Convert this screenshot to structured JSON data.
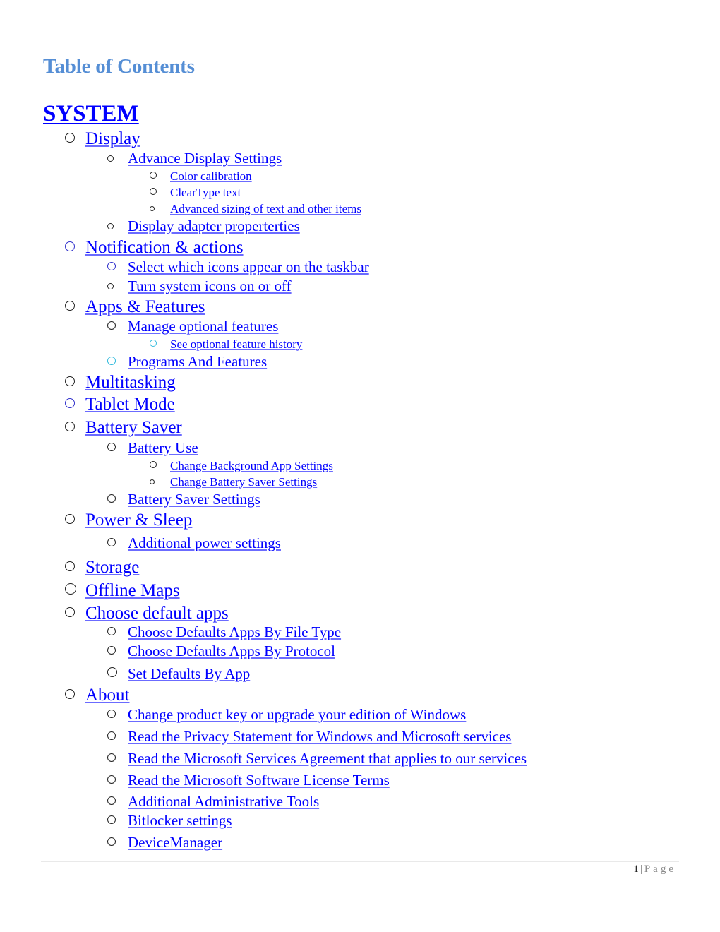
{
  "document": {
    "toc_title": "Table of Contents",
    "section_title": "SYSTEM",
    "colors": {
      "toc_title": "#558ed5",
      "link": "#0000ff",
      "bullet_default": "#222222",
      "bullet_blue": "#3333cc",
      "bullet_cyan": "#33bbdd"
    },
    "items": [
      {
        "level": 1,
        "label": "Display",
        "bullet": "default"
      },
      {
        "level": 2,
        "label": "Advance Display Settings",
        "bullet": "default"
      },
      {
        "level": 3,
        "label": "Color calibration",
        "bullet": "default"
      },
      {
        "level": 3,
        "label": "ClearType text",
        "bullet": "default"
      },
      {
        "level": 3,
        "label": "Advanced sizing of text and other items",
        "bullet": "default"
      },
      {
        "level": 2,
        "label": "Display adapter properterties",
        "bullet": "default"
      },
      {
        "level": 1,
        "label": "Notification & actions",
        "bullet": "blue"
      },
      {
        "level": 2,
        "label": "Select which icons appear on the taskbar",
        "bullet": "blue"
      },
      {
        "level": 2,
        "label": "Turn system icons on or off",
        "bullet": "default"
      },
      {
        "level": 1,
        "label": "Apps & Features",
        "bullet": "default"
      },
      {
        "level": 2,
        "label": "Manage optional features",
        "bullet": "default"
      },
      {
        "level": 3,
        "label": "See optional feature history",
        "bullet": "cyan"
      },
      {
        "level": 2,
        "label": "Programs And Features",
        "bullet": "cyan"
      },
      {
        "level": 1,
        "label": "Multitasking",
        "bullet": "default"
      },
      {
        "level": 1,
        "label": "Tablet Mode",
        "bullet": "blue"
      },
      {
        "level": 1,
        "label": "Battery Saver",
        "bullet": "default"
      },
      {
        "level": 2,
        "label": "Battery Use",
        "bullet": "default"
      },
      {
        "level": 3,
        "label": "Change Background App Settings",
        "bullet": "default"
      },
      {
        "level": 3,
        "label": "Change Battery Saver Settings",
        "bullet": "default"
      },
      {
        "level": 2,
        "label": "Battery Saver Settings",
        "bullet": "default"
      },
      {
        "level": 1,
        "label": "Power & Sleep",
        "bullet": "default"
      },
      {
        "level": 2,
        "label": "Additional power settings",
        "bullet": "default"
      },
      {
        "level": 1,
        "label": "Storage",
        "bullet": "default"
      },
      {
        "level": 1,
        "label": "Offline Maps",
        "bullet": "default"
      },
      {
        "level": 1,
        "label": "Choose default apps",
        "bullet": "default"
      },
      {
        "level": 2,
        "label": "Choose Defaults Apps By File Type",
        "bullet": "default"
      },
      {
        "level": 2,
        "label": "Choose Defaults Apps By Protocol",
        "bullet": "default"
      },
      {
        "level": 2,
        "label": "Set Defaults By App",
        "bullet": "default"
      },
      {
        "level": 1,
        "label": "About",
        "bullet": "default"
      },
      {
        "level": 2,
        "label": "Change product key or upgrade your edition of  Windows",
        "bullet": "default"
      },
      {
        "level": 2,
        "label": "Read the Privacy Statement for Windows and Microsoft services",
        "bullet": "default"
      },
      {
        "level": 2,
        "label": "Read the Microsoft Services Agreement that applies to our services",
        "bullet": "default"
      },
      {
        "level": 2,
        "label": "Read the Microsoft Software License Terms",
        "bullet": "default"
      },
      {
        "level": 2,
        "label": "Additional Administrative Tools",
        "bullet": "default"
      },
      {
        "level": 2,
        "label": "Bitlocker settings",
        "bullet": "default"
      },
      {
        "level": 2,
        "label": "DeviceManager",
        "bullet": "default"
      }
    ]
  },
  "footer": {
    "page_number": "1",
    "separator": "|",
    "page_label": "Page"
  }
}
